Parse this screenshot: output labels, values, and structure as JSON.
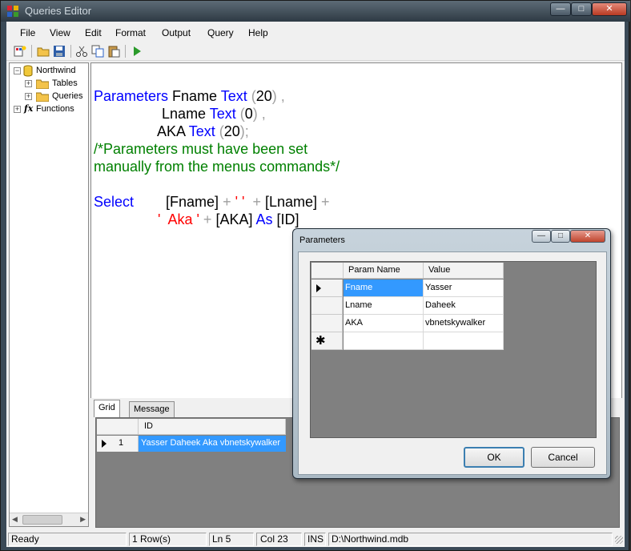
{
  "window": {
    "title": "Queries Editor"
  },
  "menu": [
    "File",
    "View",
    "Edit",
    "Format",
    "Output",
    "Query",
    "Help"
  ],
  "toolbar": {
    "icons": [
      "new-query-icon",
      "open-icon",
      "save-icon",
      "cut-icon",
      "copy-icon",
      "paste-icon",
      "run-icon"
    ]
  },
  "tree": {
    "root": "Northwind",
    "children": [
      "Tables",
      "Queries"
    ],
    "functions": "Functions"
  },
  "editor": {
    "lines": [
      [
        {
          "t": "Parameters ",
          "c": "kw"
        },
        {
          "t": "Fname ",
          "c": "id"
        },
        {
          "t": "Text ",
          "c": "kw"
        },
        {
          "t": "(",
          "c": "op"
        },
        {
          "t": "20",
          "c": "id"
        },
        {
          "t": ") ,",
          "c": "op"
        }
      ],
      [
        {
          "t": "                 ",
          "c": "id"
        },
        {
          "t": "Lname ",
          "c": "id"
        },
        {
          "t": "Text ",
          "c": "kw"
        },
        {
          "t": "(",
          "c": "op"
        },
        {
          "t": "0",
          "c": "id"
        },
        {
          "t": ") ,",
          "c": "op"
        }
      ],
      [
        {
          "t": "                ",
          "c": "id"
        },
        {
          "t": "AKA ",
          "c": "id"
        },
        {
          "t": "Text ",
          "c": "kw"
        },
        {
          "t": "(",
          "c": "op"
        },
        {
          "t": "20",
          "c": "id"
        },
        {
          "t": ");",
          "c": "op"
        }
      ],
      [
        {
          "t": "/*Parameters must have been set",
          "c": "cm"
        }
      ],
      [
        {
          "t": "manually from the menus commands*/",
          "c": "cm"
        }
      ],
      [
        {
          "t": "",
          "c": "id"
        }
      ],
      [
        {
          "t": "Select",
          "c": "kw"
        },
        {
          "t": "        [Fname] ",
          "c": "id"
        },
        {
          "t": "+ ",
          "c": "op"
        },
        {
          "t": "' '",
          "c": "str"
        },
        {
          "t": "  + ",
          "c": "op"
        },
        {
          "t": "[Lname] ",
          "c": "id"
        },
        {
          "t": "+",
          "c": "op"
        }
      ],
      [
        {
          "t": "                ",
          "c": "id"
        },
        {
          "t": "'  Aka ' ",
          "c": "str"
        },
        {
          "t": "+ ",
          "c": "op"
        },
        {
          "t": "[AKA] ",
          "c": "id"
        },
        {
          "t": "As ",
          "c": "kw"
        },
        {
          "t": "[ID]",
          "c": "id"
        }
      ]
    ]
  },
  "results": {
    "tabs": [
      "Grid",
      "Message"
    ],
    "columns": [
      "ID"
    ],
    "rows": [
      {
        "num": "1",
        "ID": "Yasser  Daheek  Aka vbnetskywalker"
      }
    ]
  },
  "status": {
    "state": "Ready",
    "rows": "1 Row(s)",
    "line": "Ln 5",
    "col": "Col 23",
    "mode": "INS",
    "file": "D:\\Northwind.mdb"
  },
  "dialog": {
    "title": "Parameters",
    "columns": [
      "Param Name",
      "Value"
    ],
    "rows": [
      {
        "name": "Fname",
        "value": "Yasser"
      },
      {
        "name": "Lname",
        "value": "Daheek"
      },
      {
        "name": "AKA",
        "value": "vbnetskywalker"
      }
    ],
    "ok_label": "OK",
    "cancel_label": "Cancel"
  }
}
